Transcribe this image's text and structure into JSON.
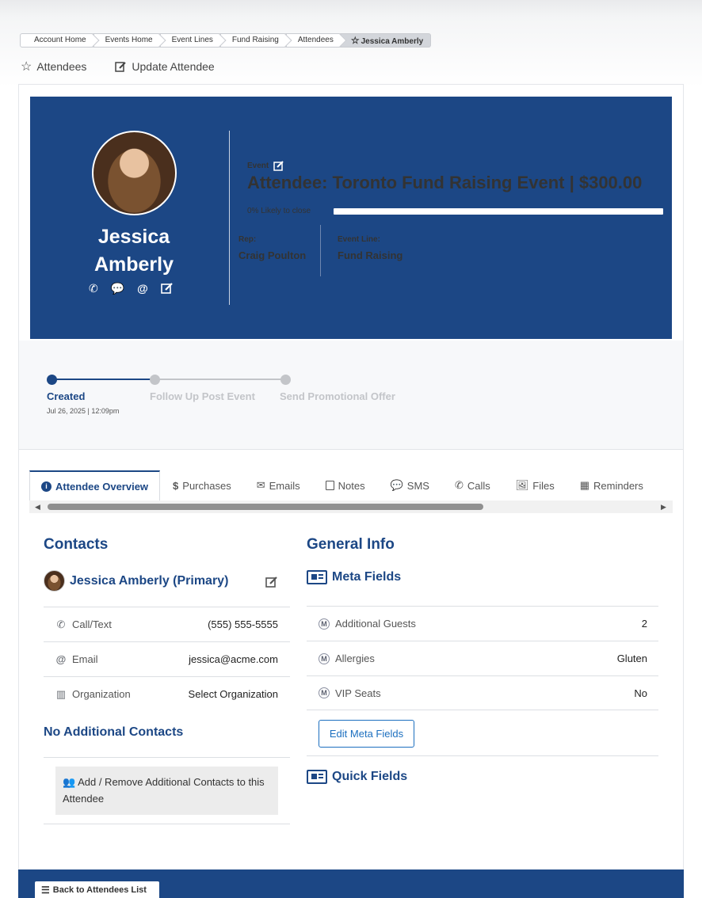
{
  "breadcrumb": [
    "Account Home",
    "Events Home",
    "Event Lines",
    "Fund Raising",
    "Attendees",
    "Jessica Amberly"
  ],
  "page_links": {
    "attendees": "Attendees",
    "update": "Update Attendee"
  },
  "hero": {
    "first_name": "Jessica",
    "last_name": "Amberly",
    "event_label": "Event",
    "event_title": "Attendee: Toronto Fund Raising Event | $300.00",
    "likely_text": "0% Likely to close",
    "likely_percent": 0,
    "rep_label": "Rep:",
    "rep_value": "Craig Poulton",
    "event_line_label": "Event Line:",
    "event_line_value": "Fund Raising"
  },
  "stepper": {
    "steps": [
      {
        "label": "Created",
        "date": "Jul 26, 2025 | 12:09pm",
        "done": true
      },
      {
        "label": "Follow Up Post Event",
        "date": "",
        "done": false
      },
      {
        "label": "Send Promotional Offer",
        "date": "",
        "done": false
      }
    ]
  },
  "tabs": [
    "Attendee Overview",
    "Purchases",
    "Emails",
    "Notes",
    "SMS",
    "Calls",
    "Files",
    "Reminders"
  ],
  "contacts": {
    "heading": "Contacts",
    "primary_name": "Jessica Amberly (Primary)",
    "rows": [
      {
        "label": "Call/Text",
        "value": "(555) 555-5555",
        "icon": "phone-icon"
      },
      {
        "label": "Email",
        "value": "jessica@acme.com",
        "icon": "at-icon"
      },
      {
        "label": "Organization",
        "value": "Select Organization",
        "icon": "building-icon"
      }
    ],
    "no_additional": "No Additional Contacts",
    "add_remove_text": "Add / Remove Additional Contacts to this Attendee"
  },
  "general": {
    "heading": "General Info",
    "meta_heading": "Meta Fields",
    "meta_rows": [
      {
        "label": "Additional Guests",
        "value": "2"
      },
      {
        "label": "Allergies",
        "value": "Gluten"
      },
      {
        "label": "VIP Seats",
        "value": "No"
      }
    ],
    "edit_meta_button": "Edit Meta Fields",
    "quick_heading": "Quick Fields"
  },
  "footer": {
    "back_button": "Back to Attendees List"
  },
  "colors": {
    "primary": "#1c4785",
    "link": "#1c6fbf",
    "inactive": "#c3c5c9"
  }
}
